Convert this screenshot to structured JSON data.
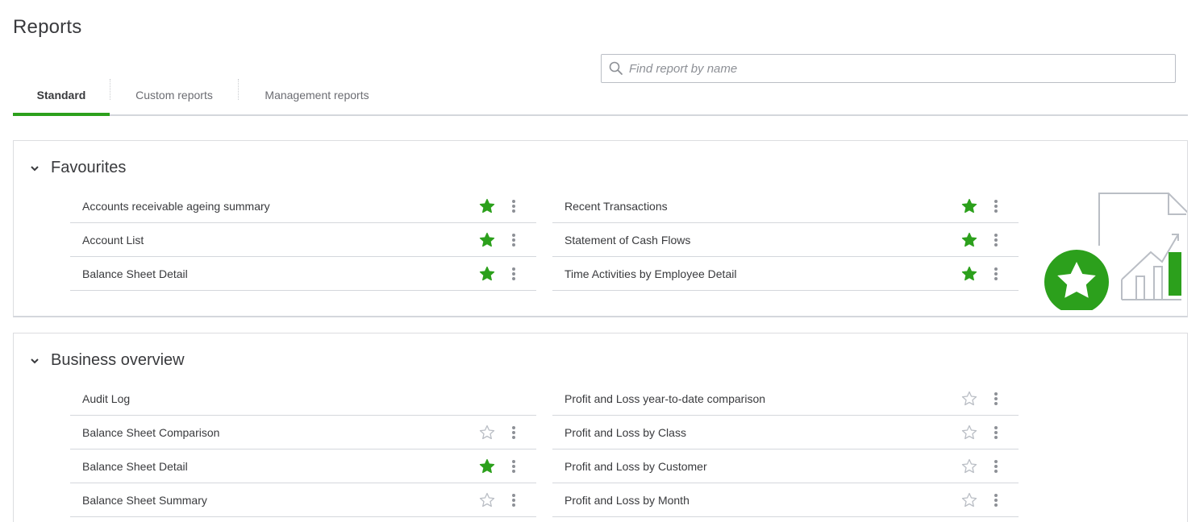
{
  "page": {
    "title": "Reports"
  },
  "search": {
    "placeholder": "Find report by name"
  },
  "tabs": [
    {
      "label": "Standard",
      "active": true
    },
    {
      "label": "Custom reports",
      "active": false
    },
    {
      "label": "Management reports",
      "active": false
    }
  ],
  "colors": {
    "accent": "#2ca01c",
    "text": "#393a3d",
    "muted": "#8d9096",
    "divider": "#d4d7dc"
  },
  "sections": {
    "favourites": {
      "title": "Favourites",
      "left": [
        {
          "name": "Accounts receivable ageing summary",
          "favourite": true
        },
        {
          "name": "Account List",
          "favourite": true
        },
        {
          "name": "Balance Sheet Detail",
          "favourite": true
        }
      ],
      "right": [
        {
          "name": "Recent Transactions",
          "favourite": true
        },
        {
          "name": "Statement of Cash Flows",
          "favourite": true
        },
        {
          "name": "Time Activities by Employee Detail",
          "favourite": true
        }
      ]
    },
    "business_overview": {
      "title": "Business overview",
      "left": [
        {
          "name": "Audit Log",
          "favourite": null
        },
        {
          "name": "Balance Sheet Comparison",
          "favourite": false
        },
        {
          "name": "Balance Sheet Detail",
          "favourite": true
        },
        {
          "name": "Balance Sheet Summary",
          "favourite": false
        }
      ],
      "right": [
        {
          "name": "Profit and Loss year-to-date comparison",
          "favourite": false
        },
        {
          "name": "Profit and Loss by Class",
          "favourite": false
        },
        {
          "name": "Profit and Loss by Customer",
          "favourite": false
        },
        {
          "name": "Profit and Loss by Month",
          "favourite": false
        }
      ]
    }
  }
}
